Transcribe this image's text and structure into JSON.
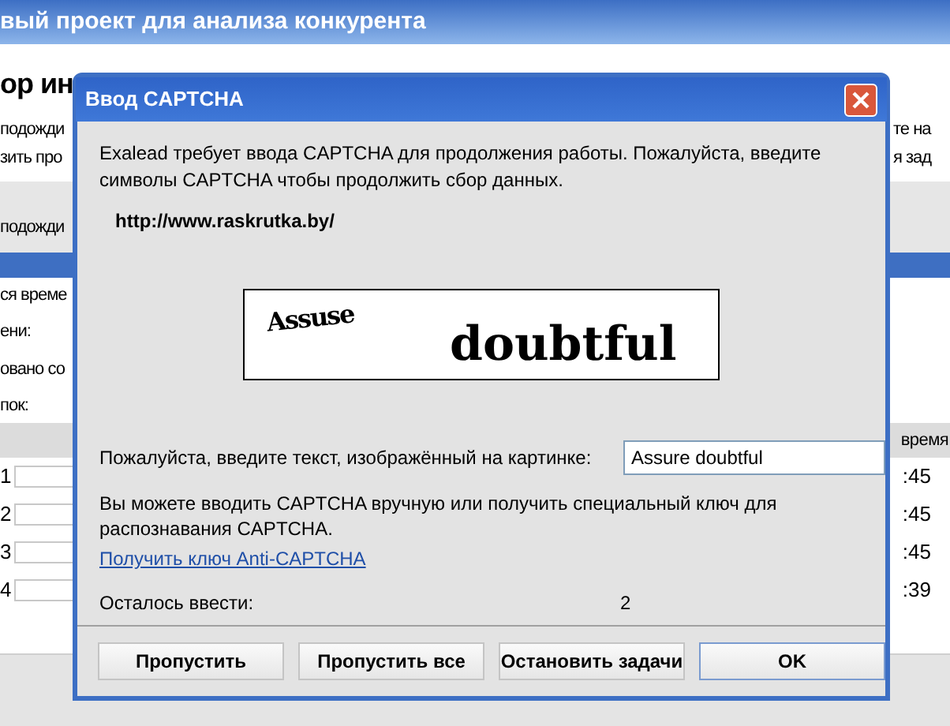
{
  "app": {
    "title": "вый проект для анализа конкурента",
    "heading": "ор ин",
    "lines_left": [
      "подожди",
      "зить про"
    ],
    "lines_right": [
      "те на",
      "я зад"
    ],
    "band_text": "подожди",
    "labels": [
      "ся време",
      "ени:",
      "овано со",
      "пок:"
    ],
    "column_header": "время",
    "rows": [
      {
        "number": "1",
        "time": ":45"
      },
      {
        "number": "2",
        "time": ":45"
      },
      {
        "number": "3",
        "time": ":45"
      },
      {
        "number": "4",
        "time": ":39"
      }
    ]
  },
  "dialog": {
    "title": "Ввод CAPTCHA",
    "message": "Exalead требует ввода CAPTCHA для продолжения работы. Пожалуйста, введите символы CAPTCHA чтобы продолжить сбор данных.",
    "url": "http://www.raskrutka.by/",
    "captcha": {
      "words": [
        "Assuse",
        "doubtful"
      ]
    },
    "prompt": "Пожалуйста, введите текст, изображённый на картинке:",
    "answer": "Assure doubtful",
    "info": "Вы можете вводить CAPTCHA вручную или получить специальный ключ для распознавания CAPTCHA.",
    "link": "Получить ключ Anti-CAPTCHA",
    "remaining_label": "Осталось ввести:",
    "remaining": "2",
    "buttons": [
      {
        "label": "Пропустить",
        "selected": false
      },
      {
        "label": "Пропустить все",
        "selected": false
      },
      {
        "label": "Остановить задачи",
        "selected": false
      },
      {
        "label": "OK",
        "selected": true
      }
    ]
  }
}
